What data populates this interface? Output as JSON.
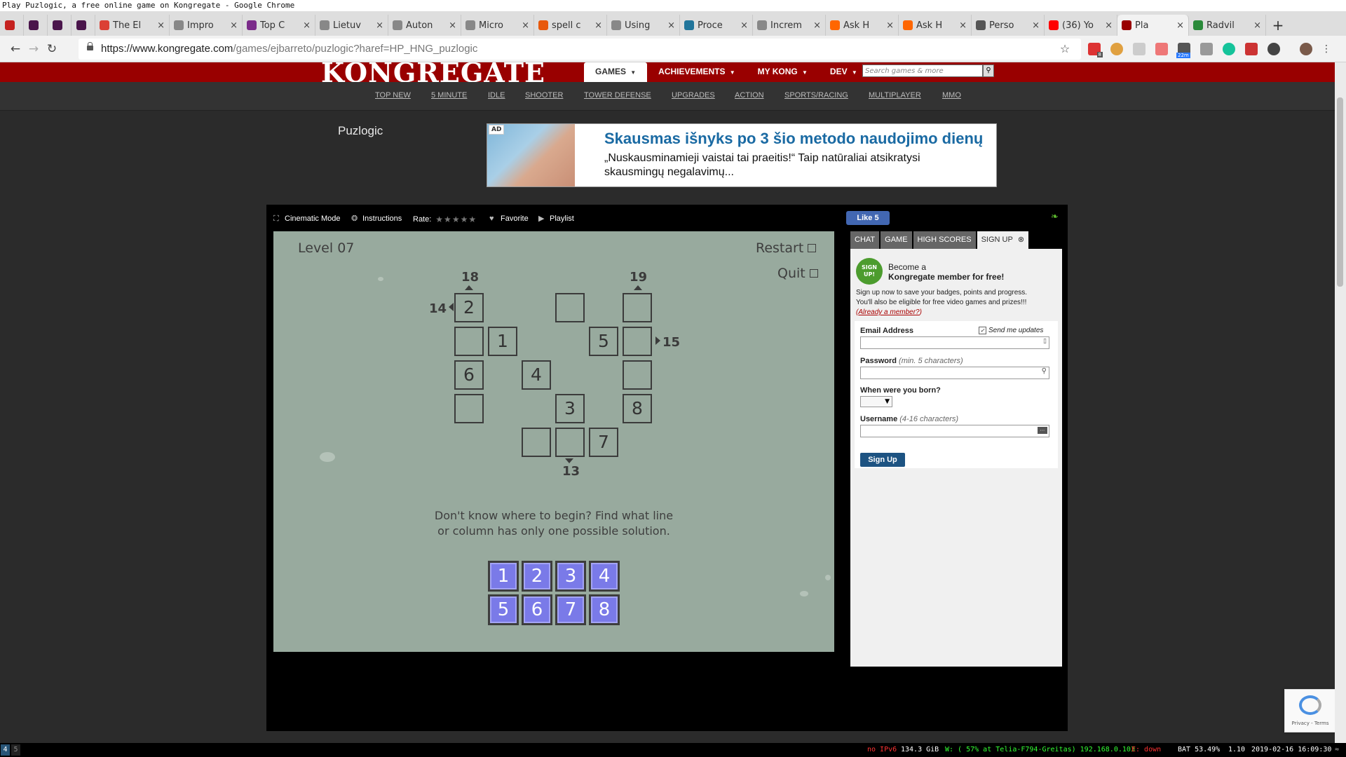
{
  "window_title": "Play Puzlogic, a free online game on Kongregate - Google Chrome",
  "tabs": [
    {
      "label": "",
      "icon": "gmail-icon",
      "color": "#c5221f"
    },
    {
      "label": "",
      "icon": "slack-icon",
      "color": "#4a154b"
    },
    {
      "label": "",
      "icon": "slack-icon",
      "color": "#4a154b"
    },
    {
      "label": "",
      "icon": "slack-icon",
      "color": "#4a154b"
    },
    {
      "label": "The El",
      "icon": "todoist-icon",
      "color": "#db4035"
    },
    {
      "label": "Impro",
      "icon": "document-icon",
      "color": "#888888"
    },
    {
      "label": "Top C",
      "icon": "seven-icon",
      "color": "#7b2b8a"
    },
    {
      "label": "Lietuv",
      "icon": "document-icon",
      "color": "#888888"
    },
    {
      "label": "Auton",
      "icon": "document-icon",
      "color": "#888888"
    },
    {
      "label": "Micro",
      "icon": "document-icon",
      "color": "#888888"
    },
    {
      "label": "spell c",
      "icon": "grammarly-icon",
      "color": "#e8590c"
    },
    {
      "label": "Using",
      "icon": "document-icon",
      "color": "#888888"
    },
    {
      "label": "Proce",
      "icon": "wordpress-icon",
      "color": "#21759b"
    },
    {
      "label": "Increm",
      "icon": "document-icon",
      "color": "#888888"
    },
    {
      "label": "Ask H",
      "icon": "ycombinator-icon",
      "color": "#ff6600"
    },
    {
      "label": "Ask H",
      "icon": "ycombinator-icon",
      "color": "#ff6600"
    },
    {
      "label": "Perso",
      "icon": "trello-icon",
      "color": "#555555"
    },
    {
      "label": "(36) Yo",
      "icon": "youtube-icon",
      "color": "#ff0000"
    },
    {
      "label": "Pla",
      "icon": "kongregate-icon",
      "color": "#990000",
      "active": true
    },
    {
      "label": "Radvil",
      "icon": "x-icon",
      "color": "#2a8a3a"
    }
  ],
  "url": {
    "host": "https://www.kongregate.com",
    "path": "/games/ejbarreto/puzlogic?haref=HP_HNG_puzlogic"
  },
  "extensions": {
    "badge1": "8",
    "badge2": "22m"
  },
  "kong": {
    "logo": "KONGREGATE",
    "nav": [
      "GAMES",
      "ACHIEVEMENTS",
      "MY KONG",
      "DEV"
    ],
    "search_placeholder": "Search games & more",
    "subnav": [
      "TOP NEW",
      "5 MINUTE",
      "IDLE",
      "SHOOTER",
      "TOWER DEFENSE",
      "UPGRADES",
      "ACTION",
      "SPORTS/RACING",
      "MULTIPLAYER",
      "MMO"
    ],
    "game_title": "Puzlogic"
  },
  "ad": {
    "tag": "AD",
    "headline": "Skausmas išnyks po 3 šio metodo naudojimo dienų",
    "body": "„Nuskausminamieji vaistai tai praeitis!“ Taip natūraliai atsikratysi skausmingų negalavimų..."
  },
  "game_toolbar": {
    "cinematic": "Cinematic Mode",
    "instructions": "Instructions",
    "rate": "Rate:",
    "stars": 0,
    "favorite": "Favorite",
    "playlist": "Playlist",
    "fb_like": "Like 5"
  },
  "game": {
    "level": "Level 07",
    "restart": "Restart",
    "quit": "Quit",
    "hint_line1": "Don't know where to begin? Find what line",
    "hint_line2": "or column has only one possible solution.",
    "clues": {
      "col1_top": "18",
      "col5_top": "19",
      "row1_left": "14",
      "row2_right": "15",
      "col4_bottom": "13"
    },
    "grid": [
      {
        "id": "r1c1",
        "value": "2"
      },
      {
        "id": "r1c4",
        "value": ""
      },
      {
        "id": "r1c6",
        "value": ""
      },
      {
        "id": "r2c1",
        "value": ""
      },
      {
        "id": "r2c2",
        "value": "1"
      },
      {
        "id": "r2c5",
        "value": "5"
      },
      {
        "id": "r2c6",
        "value": ""
      },
      {
        "id": "r3c1",
        "value": "6"
      },
      {
        "id": "r3c3",
        "value": "4"
      },
      {
        "id": "r3c6",
        "value": ""
      },
      {
        "id": "r4c1",
        "value": ""
      },
      {
        "id": "r4c4",
        "value": "3"
      },
      {
        "id": "r4c6",
        "value": "8"
      },
      {
        "id": "r5c3",
        "value": ""
      },
      {
        "id": "r5c4",
        "value": ""
      },
      {
        "id": "r5c5",
        "value": "7"
      }
    ],
    "pieces": [
      "1",
      "2",
      "3",
      "4",
      "5",
      "6",
      "7",
      "8"
    ]
  },
  "sidepanel": {
    "tabs": [
      "CHAT",
      "GAME",
      "HIGH SCORES",
      "SIGN UP"
    ],
    "badge": "SIGN UP!",
    "become_line1": "Become a",
    "become_line2": "Kongregate member for free!",
    "info1": "Sign up now to save your badges, points and progress.",
    "info2": "You'll also be eligible for free video games and prizes!!!",
    "already_member": "Already a member?",
    "email_label": "Email Address",
    "send_updates": "Send me updates",
    "password_label": "Password",
    "password_hint": "(min. 5 characters)",
    "born_label": "When were you born?",
    "username_label": "Username",
    "username_hint": "(4-16 characters)",
    "signup_button": "Sign Up"
  },
  "recaptcha": {
    "text": "Privacy - Terms"
  },
  "statusbar": {
    "ws1": "4",
    "ws2": "5",
    "ipv6": "no IPv6",
    "disk": "134.3 GiB",
    "wifi": "W: ( 57% at Telia-F794-Greitas) 192.168.0.103",
    "eth": "E: down",
    "bat": "BAT 53.49%",
    "load": "1.10",
    "time": "2019-02-16 16:09:30"
  }
}
